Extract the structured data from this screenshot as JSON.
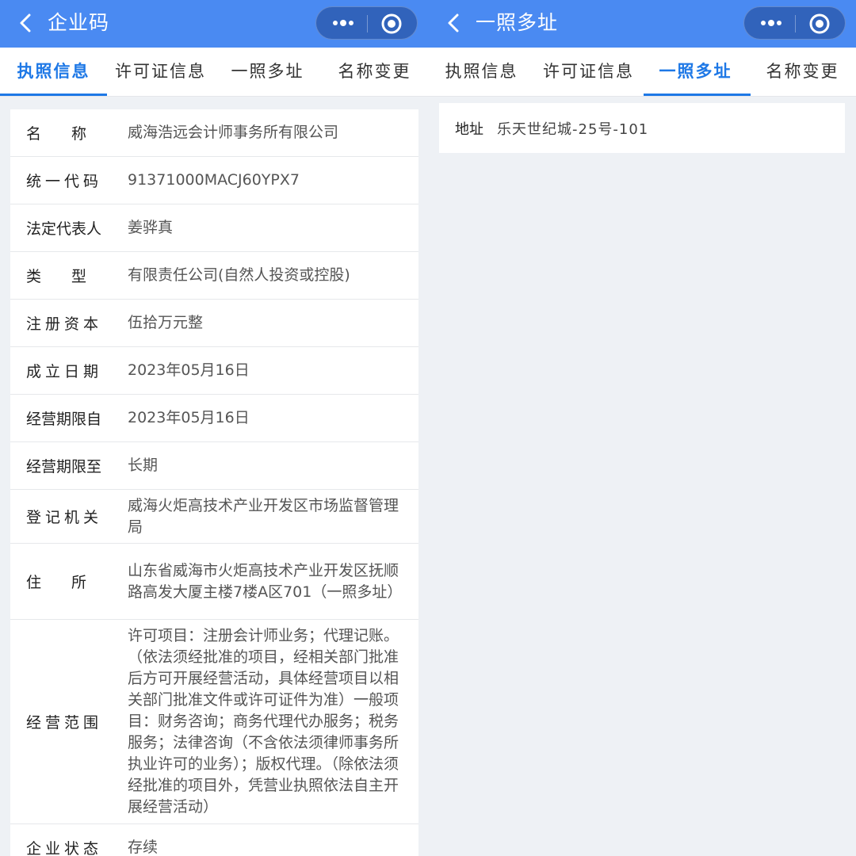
{
  "left": {
    "title": "企业码",
    "tabs": [
      {
        "label": "执照信息",
        "active": true
      },
      {
        "label": "许可证信息",
        "active": false
      },
      {
        "label": "一照多址",
        "active": false
      },
      {
        "label": "名称变更",
        "active": false
      }
    ],
    "rows": [
      {
        "label": "名　　称",
        "value": "威海浩远会计师事务所有限公司"
      },
      {
        "label": "统一代码",
        "value": "91371000MACJ60YPX7"
      },
      {
        "label": "法定代表人",
        "value": "姜骅真"
      },
      {
        "label": "类　　型",
        "value": "有限责任公司(自然人投资或控股)"
      },
      {
        "label": "注册资本",
        "value": "伍拾万元整"
      },
      {
        "label": "成立日期",
        "value": "2023年05月16日"
      },
      {
        "label": "经营期限自",
        "value": "2023年05月16日"
      },
      {
        "label": "经营期限至",
        "value": "长期"
      },
      {
        "label": "登记机关",
        "value": "威海火炬高技术产业开发区市场监督管理局"
      },
      {
        "label": "住　　所",
        "value": "山东省威海市火炬高技术产业开发区抚顺路高发大厦主楼7楼A区701（一照多址）"
      },
      {
        "label": "经营范围",
        "value": "许可项目：注册会计师业务；代理记账。（依法须经批准的项目，经相关部门批准后方可开展经营活动，具体经营项目以相关部门批准文件或许可证件为准）一般项目：财务咨询；商务代理代办服务；税务服务；法律咨询（不含依法须律师事务所执业许可的业务）；版权代理。（除依法须经批准的项目外，凭营业执照依法自主开展经营活动）"
      },
      {
        "label": "企业状态",
        "value": "存续"
      }
    ]
  },
  "right": {
    "title": "一照多址",
    "tabs": [
      {
        "label": "执照信息",
        "active": false
      },
      {
        "label": "许可证信息",
        "active": false
      },
      {
        "label": "一照多址",
        "active": true
      },
      {
        "label": "名称变更",
        "active": false
      }
    ],
    "address": {
      "label": "地址",
      "value": "乐天世纪城-25号-101"
    }
  },
  "colors": {
    "titlebar": "#4a8af2",
    "accent": "#1e78e6",
    "background": "#eef1f5"
  }
}
